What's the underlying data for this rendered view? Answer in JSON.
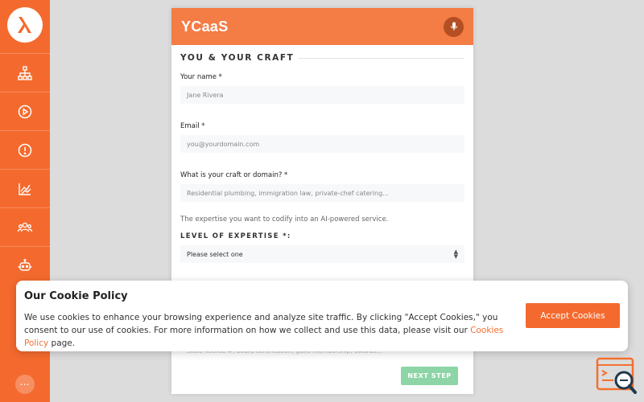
{
  "sidebar": {
    "logo_icon": "lambda-logo-icon",
    "items": [
      {
        "icon": "sitemap-icon"
      },
      {
        "icon": "play-circle-icon"
      },
      {
        "icon": "alert-circle-icon"
      },
      {
        "icon": "chart-line-icon"
      },
      {
        "icon": "users-icon"
      },
      {
        "icon": "robot-icon"
      }
    ],
    "more_label": "⋯"
  },
  "form": {
    "brand": "YCaaS",
    "section_title": "YOU & YOUR CRAFT",
    "name_label": "Your name *",
    "name_placeholder": "Jane Rivera",
    "email_label": "Email *",
    "email_placeholder": "you@yourdomain.com",
    "craft_label": "What is your craft or domain? *",
    "craft_placeholder": "Residential plumbing, immigration law, private-chef catering...",
    "craft_hint": "The expertise you want to codify into an AI-powered service.",
    "level_label": "LEVEL OF EXPERTISE *:",
    "level_selected": "Please select one",
    "credentials_placeholder": "State license #, board certification, guild membership, awards...",
    "next_label": "NEXT STEP"
  },
  "cookie": {
    "title": "Our Cookie Policy",
    "text_before": "We use cookies to enhance your browsing experience and analyze site traffic. By clicking \"Accept Cookies,\" you consent to our use of cookies. For more information on how we collect and use this data, please visit our ",
    "link_text": "Cookies Policy",
    "text_after": " page.",
    "accept_label": "Accept Cookies"
  },
  "colors": {
    "sidebar": "#f46a2e",
    "header": "#f47c45",
    "next_button": "#8dd5a6",
    "link": "#f4702f"
  }
}
